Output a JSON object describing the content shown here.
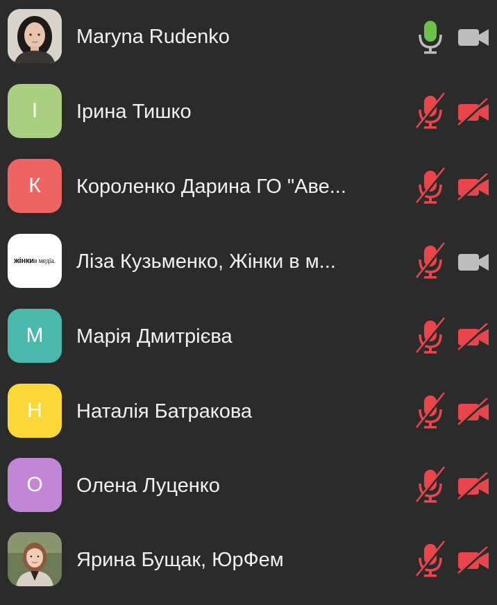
{
  "participants": [
    {
      "name": "Maryna Rudenko",
      "avatar": {
        "type": "photo",
        "desc": "woman-dark-hair"
      },
      "mic": "active",
      "camera": "off-neutral"
    },
    {
      "name": "Ірина Тишко",
      "avatar": {
        "type": "initial",
        "initial": "І",
        "color": "#a8d080"
      },
      "mic": "muted",
      "camera": "off"
    },
    {
      "name": "Короленко Дарина ГО \"Аве...",
      "avatar": {
        "type": "initial",
        "initial": "К",
        "color": "#f06464"
      },
      "mic": "muted",
      "camera": "off"
    },
    {
      "name": "Ліза Кузьменко, Жінки в м...",
      "avatar": {
        "type": "logo",
        "logo_bold": "жінки",
        "logo_rest": "в медіа.",
        "color": "#ffffff"
      },
      "mic": "muted",
      "camera": "off-neutral"
    },
    {
      "name": "Марія Дмитрієва",
      "avatar": {
        "type": "initial",
        "initial": "М",
        "color": "#4bb8ad"
      },
      "mic": "muted",
      "camera": "off"
    },
    {
      "name": "Наталія Батракова",
      "avatar": {
        "type": "initial",
        "initial": "Н",
        "color": "#fbd738"
      },
      "mic": "muted",
      "camera": "off"
    },
    {
      "name": "Олена Луценко",
      "avatar": {
        "type": "initial",
        "initial": "О",
        "color": "#c286d6"
      },
      "mic": "muted",
      "camera": "off"
    },
    {
      "name": "Ярина Бущак, ЮрФем",
      "avatar": {
        "type": "photo",
        "desc": "woman-light-hair"
      },
      "mic": "muted",
      "camera": "off"
    }
  ],
  "colors": {
    "background": "#2b2b2b",
    "text": "#f2f2f2",
    "muted_red": "#e8464a",
    "active_green": "#6cc24a",
    "neutral_gray": "#bdbdbd"
  }
}
